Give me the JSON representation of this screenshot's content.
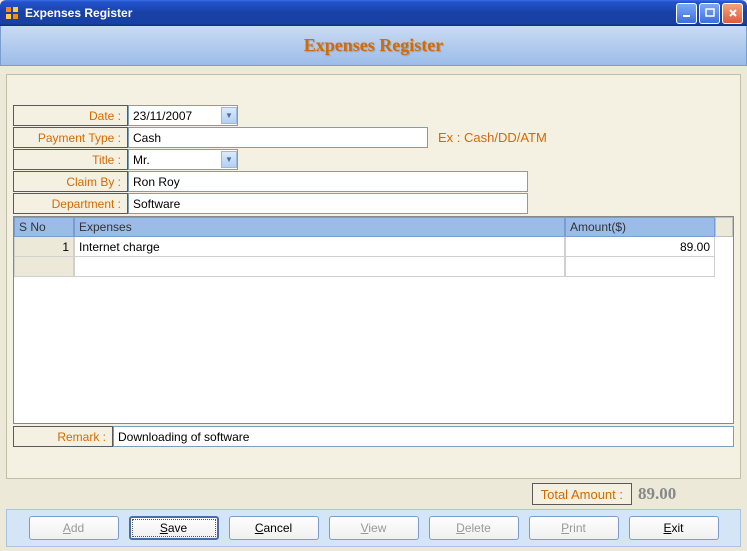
{
  "window": {
    "title": "Expenses Register"
  },
  "header": {
    "title": "Expenses Register"
  },
  "form": {
    "date_label": "Date :",
    "date_value": "23/11/2007",
    "payment_type_label": "Payment Type :",
    "payment_type_value": "Cash",
    "payment_hint": "Ex : Cash/DD/ATM",
    "title_label": "Title :",
    "title_value": "Mr.",
    "claim_by_label": "Claim By :",
    "claim_by_value": "Ron Roy",
    "department_label": "Department :",
    "department_value": "Software",
    "remark_label": "Remark :",
    "remark_value": "Downloading of software",
    "total_label": "Total Amount :",
    "total_value": "89.00"
  },
  "grid": {
    "headers": {
      "sno": "S No",
      "expense": "Expenses",
      "amount": "Amount($)"
    },
    "rows": [
      {
        "sno": "1",
        "expense": "Internet charge",
        "amount": "89.00"
      },
      {
        "sno": "",
        "expense": "",
        "amount": ""
      }
    ]
  },
  "buttons": {
    "add": "Add",
    "save": "Save",
    "cancel": "Cancel",
    "view": "View",
    "delete": "Delete",
    "print": "Print",
    "exit": "Exit"
  }
}
